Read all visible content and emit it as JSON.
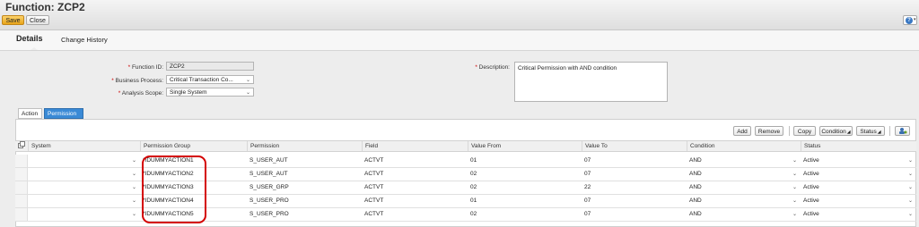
{
  "header": {
    "title": "Function: ZCP2",
    "save_label": "Save",
    "close_label": "Close",
    "help_icon": "help-icon"
  },
  "tabs": {
    "details": "Details",
    "change_history": "Change History"
  },
  "form": {
    "function_id_label": "Function ID:",
    "function_id_value": "ZCP2",
    "business_process_label": "Business Process:",
    "business_process_value": "Critical Transaction Co...",
    "analysis_scope_label": "Analysis Scope:",
    "analysis_scope_value": "Single System",
    "description_label": "Description:",
    "description_value": "Critical Permission with AND condition"
  },
  "subtabs": {
    "action": "Action",
    "permission": "Permission"
  },
  "toolbar": {
    "add": "Add",
    "remove": "Remove",
    "copy": "Copy",
    "condition": "Condition",
    "status": "Status"
  },
  "table": {
    "columns": [
      "System",
      "Permission Group",
      "Permission",
      "Field",
      "Value From",
      "Value To",
      "Condition",
      "Status"
    ],
    "rows": [
      {
        "system": "",
        "group": "*IDUMMYACTION1",
        "permission": "S_USER_AUT",
        "field": "ACTVT",
        "from": "01",
        "to": "07",
        "condition": "AND",
        "status": "Active"
      },
      {
        "system": "",
        "group": "*IDUMMYACTION2",
        "permission": "S_USER_AUT",
        "field": "ACTVT",
        "from": "02",
        "to": "07",
        "condition": "AND",
        "status": "Active"
      },
      {
        "system": "",
        "group": "*IDUMMYACTION3",
        "permission": "S_USER_GRP",
        "field": "ACTVT",
        "from": "02",
        "to": "22",
        "condition": "AND",
        "status": "Active"
      },
      {
        "system": "",
        "group": "*IDUMMYACTION4",
        "permission": "S_USER_PRO",
        "field": "ACTVT",
        "from": "01",
        "to": "07",
        "condition": "AND",
        "status": "Active"
      },
      {
        "system": "",
        "group": "*IDUMMYACTION5",
        "permission": "S_USER_PRO",
        "field": "ACTVT",
        "from": "02",
        "to": "07",
        "condition": "AND",
        "status": "Active"
      }
    ]
  },
  "colors": {
    "save_button": "#f0b92e",
    "active_tab": "#3a8ad6",
    "highlight_circle": "#d40000"
  }
}
